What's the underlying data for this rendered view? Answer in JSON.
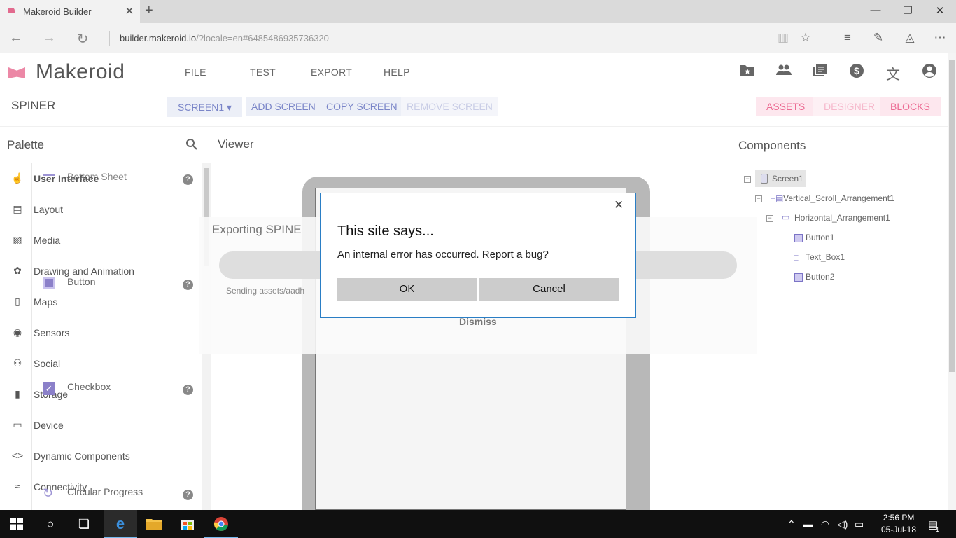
{
  "browser": {
    "tab_title": "Makeroid Builder",
    "tab_close": "✕",
    "new_tab": "+",
    "url_host": "builder.makeroid.io",
    "url_path": "/?locale=en#6485486935736320",
    "window_controls": {
      "minimize": "—",
      "restore": "❐",
      "close": "✕"
    },
    "nav": {
      "back": "←",
      "forward": "→",
      "refresh": "↻"
    },
    "toolbar_icons": [
      "reading-view-icon",
      "favorite-star-icon",
      "hub-icon",
      "web-note-icon",
      "share-icon",
      "more-icon"
    ]
  },
  "app": {
    "brand": "Makeroid",
    "menu": [
      "FILE",
      "TEST",
      "EXPORT",
      "HELP"
    ],
    "header_icons": [
      "folder-star-icon",
      "people-icon",
      "library-icon",
      "dollar-icon",
      "translate-icon",
      "account-icon"
    ],
    "project_name": "SPINER",
    "screen_select": "SCREEN1 ▾",
    "add_screen": "ADD SCREEN",
    "copy_screen": "COPY SCREEN",
    "remove_screen": "REMOVE SCREEN",
    "assets": "ASSETS",
    "designer": "DESIGNER",
    "blocks": "BLOCKS",
    "accent_color": "#ec6b93",
    "button_color": "#7a85c8"
  },
  "palette": {
    "title": "Palette",
    "categories": [
      "User Interface",
      "Layout",
      "Media",
      "Drawing and Animation",
      "Maps",
      "Sensors",
      "Social",
      "Storage",
      "Device",
      "Dynamic Components",
      "Connectivity"
    ],
    "items": [
      "Bottom Sheet",
      "Button",
      "Checkbox",
      "Circular Progress"
    ],
    "help_glyph": "?"
  },
  "viewer": {
    "title": "Viewer",
    "export_title": "Exporting SPINE",
    "export_status": "Sending assets/aadh",
    "dismiss": "Dismiss"
  },
  "components": {
    "title": "Components",
    "tree": [
      "Screen1",
      "Vertical_Scroll_Arrangement1",
      "Horizontal_Arrangement1",
      "Button1",
      "Text_Box1",
      "Button2"
    ]
  },
  "dialog": {
    "title": "This site says...",
    "message": "An internal error has occurred. Report a bug?",
    "ok": "OK",
    "cancel": "Cancel",
    "close": "✕"
  },
  "taskbar": {
    "time": "2:56 PM",
    "date": "05-Jul-18",
    "notifications": "1"
  }
}
